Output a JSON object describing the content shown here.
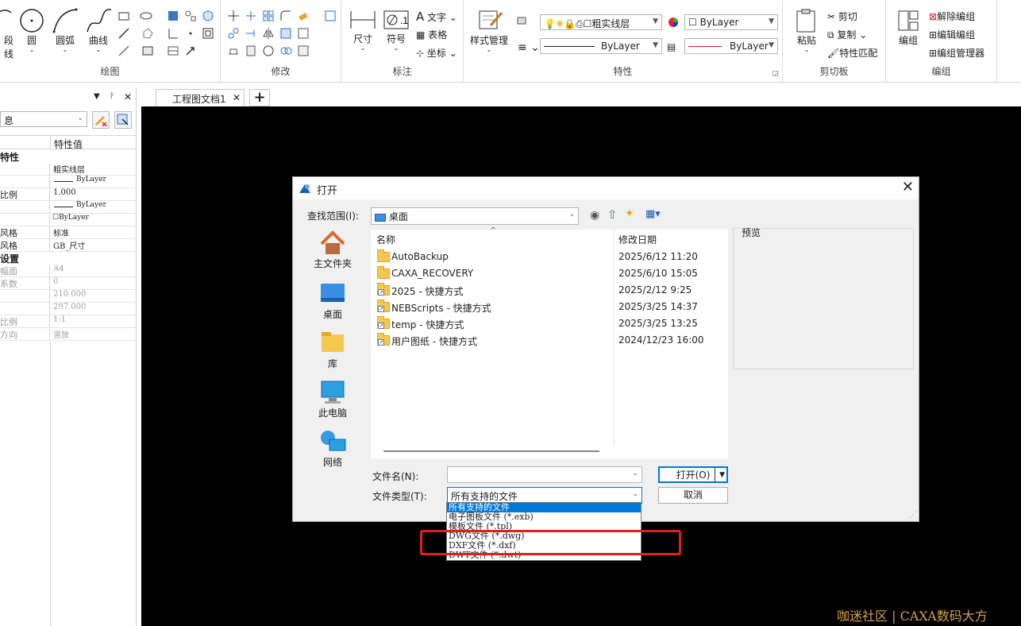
{
  "ribbon": {
    "draw_group": {
      "label": "绘图",
      "tools": [
        "段线",
        "圆",
        "圆弧",
        "曲线"
      ]
    },
    "modify_group": {
      "label": "修改"
    },
    "annotate_group": {
      "label": "标注",
      "tools": [
        "尺寸",
        "符号"
      ],
      "small_tools": [
        "文字",
        "表格",
        "坐标"
      ]
    },
    "properties_group": {
      "label": "特性",
      "style_manager": "样式管理",
      "layer": "粗实线层",
      "color": "ByLayer",
      "linetype": "ByLayer",
      "lineweight": "ByLayer"
    },
    "clipboard_group": {
      "label": "剪切板",
      "paste": "粘贴",
      "cut": "剪切",
      "copy": "复制",
      "match": "特性匹配"
    },
    "block_group": {
      "label": "编组",
      "edit": "编组",
      "ungroup": "解除编组",
      "edit_group": "编辑编组",
      "manager": "编组管理器"
    }
  },
  "properties_panel": {
    "combo_value": "息",
    "column_value": "特性值",
    "section1": "特性",
    "section2": "设置",
    "rows": [
      {
        "label": "",
        "value": "粗实线层",
        "gray": false
      },
      {
        "label": "",
        "value": "ByLayer",
        "gray": false
      },
      {
        "label": "比例",
        "value": "1.000",
        "gray": false
      },
      {
        "label": "",
        "value": "ByLayer",
        "gray": false
      },
      {
        "label": "",
        "value": "ByLayer",
        "gray": false
      },
      {
        "label": "风格",
        "value": "标准",
        "gray": false
      },
      {
        "label": "风格",
        "value": "GB_尺寸",
        "gray": false
      }
    ],
    "rows2": [
      {
        "label": "幅面",
        "value": "A4",
        "gray": true
      },
      {
        "label": "系数",
        "value": "0",
        "gray": true
      },
      {
        "label": "",
        "value": "210.000",
        "gray": true
      },
      {
        "label": "",
        "value": "297.000",
        "gray": true
      },
      {
        "label": "比例",
        "value": "1:1",
        "gray": true
      },
      {
        "label": "方向",
        "value": "竖放",
        "gray": true
      }
    ]
  },
  "tabs": {
    "doc_tab": "工程图文档1",
    "add": "+"
  },
  "dialog": {
    "title": "打开",
    "lookin_label": "查找范围(I):",
    "lookin_value": "桌面",
    "places": [
      "主文件夹",
      "桌面",
      "库",
      "此电脑",
      "网络"
    ],
    "columns": {
      "name": "名称",
      "date": "修改日期"
    },
    "files": [
      {
        "name": "AutoBackup",
        "date": "2025/6/12 11:20",
        "shortcut": false
      },
      {
        "name": "CAXA_RECOVERY",
        "date": "2025/6/10 15:05",
        "shortcut": false
      },
      {
        "name": "2025 - 快捷方式",
        "date": "2025/2/12 9:25",
        "shortcut": true
      },
      {
        "name": "NEBScripts - 快捷方式",
        "date": "2025/3/25 14:37",
        "shortcut": true
      },
      {
        "name": "temp - 快捷方式",
        "date": "2025/3/25 13:25",
        "shortcut": true
      },
      {
        "name": "用户图纸 - 快捷方式",
        "date": "2024/12/23 16:00",
        "shortcut": true
      }
    ],
    "preview_label": "预览",
    "filename_label": "文件名(N):",
    "filename_value": "",
    "filetype_label": "文件类型(T):",
    "filetype_value": "所有支持的文件",
    "open_button": "打开(O)",
    "cancel_button": "取消",
    "filetype_options": [
      "所有支持的文件",
      "电子图板文件 (*.exb)",
      "模板文件 (*.tpl)",
      "DWG文件 (*.dwg)",
      "DXF文件 (*.dxf)",
      "DWT文件 (*.dwt)"
    ]
  },
  "watermark": "咖迷社区 | CAXA数码大方",
  "colors": {
    "accent": "#0078d7",
    "highlight_box": "#e02020",
    "canvas": "#000000"
  }
}
